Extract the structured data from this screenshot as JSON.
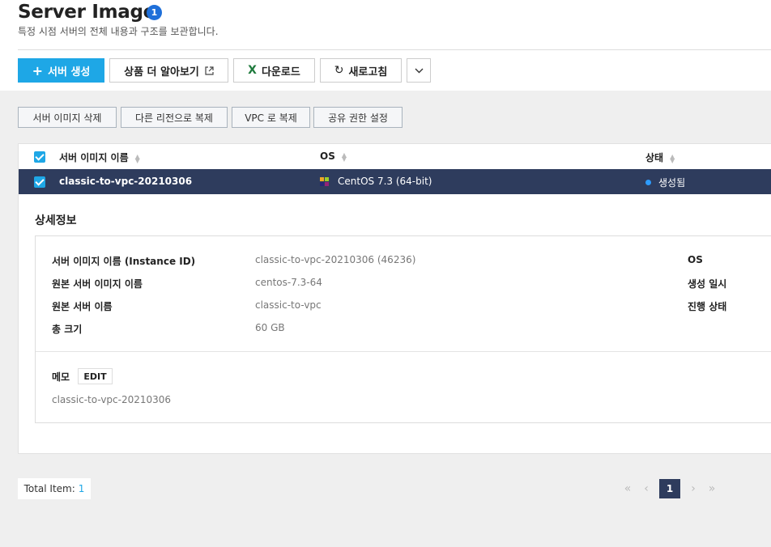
{
  "header": {
    "title": "Server Image",
    "badge": "1",
    "subtitle": "특정 시점 서버의 전체 내용과 구조를 보관합니다."
  },
  "toolbar": {
    "create_label": "서버 생성",
    "learn_more_label": "상품 더 알아보기",
    "download_label": "다운로드",
    "refresh_label": "새로고침"
  },
  "actions": {
    "delete_label": "서버 이미지 삭제",
    "copy_region_label": "다른 리전으로 복제",
    "copy_vpc_label": "VPC 로 복제",
    "share_label": "공유 권한 설정"
  },
  "table": {
    "columns": [
      "서버 이미지 이름",
      "OS",
      "상태"
    ],
    "rows": [
      {
        "name": "classic-to-vpc-20210306",
        "os": "CentOS 7.3 (64-bit)",
        "status": "생성됨"
      }
    ]
  },
  "detail": {
    "section_title": "상세정보",
    "fields": [
      {
        "label": "서버 이미지 이름 (Instance ID)",
        "value": "classic-to-vpc-20210306 (46236)"
      },
      {
        "label": "원본 서버 이미지 이름",
        "value": "centos-7.3-64"
      },
      {
        "label": "원본 서버 이름",
        "value": "classic-to-vpc"
      },
      {
        "label": "총 크기",
        "value": "60 GB"
      }
    ],
    "right_labels": [
      "OS",
      "생성 일시",
      "진행 상태"
    ],
    "memo_label": "메모",
    "edit_label": "EDIT",
    "memo_value": "classic-to-vpc-20210306"
  },
  "footer": {
    "total_label": "Total Item:",
    "total_count": "1",
    "current_page": "1"
  },
  "colors": {
    "primary": "#1ea7e6",
    "selected_row": "#2e3c5d",
    "status_dot": "#2d9cff",
    "badge": "#1e6fd9"
  },
  "icons": [
    "plus-icon",
    "external-link-icon",
    "excel-icon",
    "refresh-icon",
    "chevron-down-icon",
    "sort-icon",
    "checkbox-icon",
    "centos-icon",
    "status-dot-icon",
    "first-page-icon",
    "prev-page-icon",
    "next-page-icon",
    "last-page-icon"
  ]
}
